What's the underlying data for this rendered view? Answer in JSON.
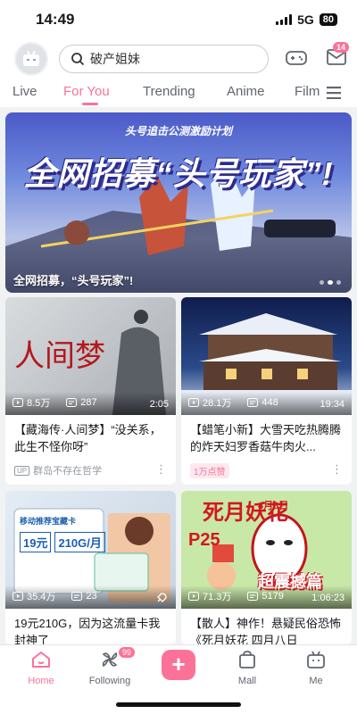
{
  "status": {
    "time": "14:49",
    "network": "5G",
    "battery": "80"
  },
  "header": {
    "search_text": "破产姐妹",
    "mail_badge": "14"
  },
  "tabs": [
    {
      "label": "Live"
    },
    {
      "label": "For You"
    },
    {
      "label": "Trending"
    },
    {
      "label": "Anime"
    },
    {
      "label": "Film"
    }
  ],
  "banner": {
    "top_text": "头号追击公测激励计划",
    "headline": "全网招募“头号玩家”!",
    "caption": "全网招募，“头号玩家”!"
  },
  "cards": [
    {
      "views": "8.5万",
      "comments": "287",
      "duration": "2:05",
      "overlay_title": "人间梦",
      "title": "【藏海传·人间梦】“没关系，此生不怪你呀”",
      "uploader": "群岛不存在哲学",
      "tag": "UP"
    },
    {
      "views": "28.1万",
      "comments": "448",
      "duration": "19:34",
      "title": "【蜡笔小新】大雪天吃热腾腾的炸天妇罗香菇牛肉火...",
      "likes_badge": "1万点赞"
    },
    {
      "views": "35.4万",
      "comments": "23",
      "ad_line1": "移动推荐宝藏卡",
      "ad_price": "19元",
      "ad_data": "210G/月",
      "title": "19元210G，因为这流量卡我封神了"
    },
    {
      "views": "71.3万",
      "comments": "5179",
      "duration": "1:06:23",
      "poster_title": "死月妖花",
      "poster_sub": "超震撼篇",
      "poster_date": "4月8日",
      "poster_code": "P25",
      "title": "【散人】神作！悬疑民俗恐怖《死月妖花 四月八日"
    }
  ],
  "bottom_nav": [
    {
      "label": "Home"
    },
    {
      "label": "Following",
      "badge": "99"
    },
    {
      "label": ""
    },
    {
      "label": "Mall"
    },
    {
      "label": "Me"
    }
  ],
  "colors": {
    "accent": "#fb7299",
    "background": "#f1f2f3"
  }
}
